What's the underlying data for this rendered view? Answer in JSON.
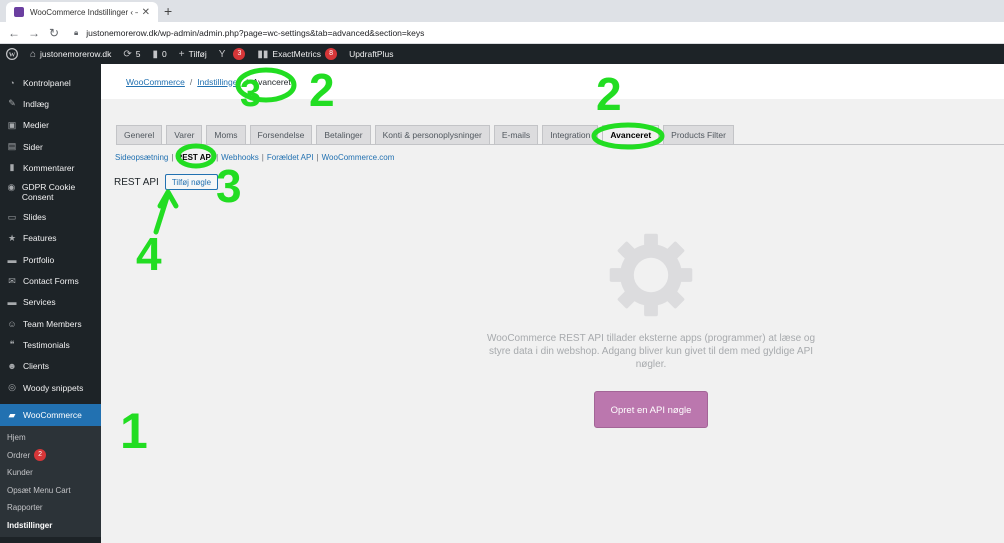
{
  "browser": {
    "tab_title": "WooCommerce Indstillinger ‹ —",
    "url": "justonemorerow.dk/wp-admin/admin.php?page=wc-settings&tab=advanced&section=keys"
  },
  "adminbar": {
    "site": "justonemorerow.dk",
    "updates": "5",
    "comments": "0",
    "new": "Tilføj",
    "yoast_badge": "3",
    "exactmetrics": "ExactMetrics",
    "exactmetrics_badge": "8",
    "updraft": "UpdraftPlus"
  },
  "sidebar": {
    "items": [
      {
        "label": "Kontrolpanel"
      },
      {
        "label": "Indlæg"
      },
      {
        "label": "Medier"
      },
      {
        "label": "Sider"
      },
      {
        "label": "Kommentarer"
      },
      {
        "label": "GDPR Cookie Consent"
      },
      {
        "label": "Slides"
      },
      {
        "label": "Features"
      },
      {
        "label": "Portfolio"
      },
      {
        "label": "Contact Forms"
      },
      {
        "label": "Services"
      },
      {
        "label": "Team Members"
      },
      {
        "label": "Testimonials"
      },
      {
        "label": "Clients"
      },
      {
        "label": "Woody snippets"
      }
    ],
    "active": "WooCommerce",
    "sub": [
      "Hjem",
      "Ordrer",
      "Kunder",
      "Opsæt Menu Cart",
      "Rapporter",
      "Indstillinger"
    ],
    "orders_badge": "2"
  },
  "breadcrumb": {
    "root": "WooCommerce",
    "parent": "Indstillinger",
    "current": "Avanceret"
  },
  "tabs": [
    "Generel",
    "Varer",
    "Moms",
    "Forsendelse",
    "Betalinger",
    "Konti & personoplysninger",
    "E-mails",
    "Integration",
    "Avanceret",
    "Products Filter"
  ],
  "subsections": [
    "Sideopsætning",
    "REST API",
    "Webhooks",
    "Forældet API",
    "WooCommerce.com"
  ],
  "section": {
    "title": "REST API",
    "add_button": "Tilføj nøgle"
  },
  "blank_state": {
    "message": "WooCommerce REST API tillader eksterne apps (programmer) at læse og styre data i din webshop. Adgang bliver kun givet til dem med gyldige API nøgler.",
    "button": "Opret en API nøgle"
  },
  "annotations": [
    "1",
    "2",
    "2",
    "3",
    "3",
    "4"
  ],
  "colors": {
    "annotation": "#22dd22",
    "wp_dark": "#1d2327",
    "wp_blue": "#2271b1",
    "woo_purple": "#bb77ae"
  }
}
